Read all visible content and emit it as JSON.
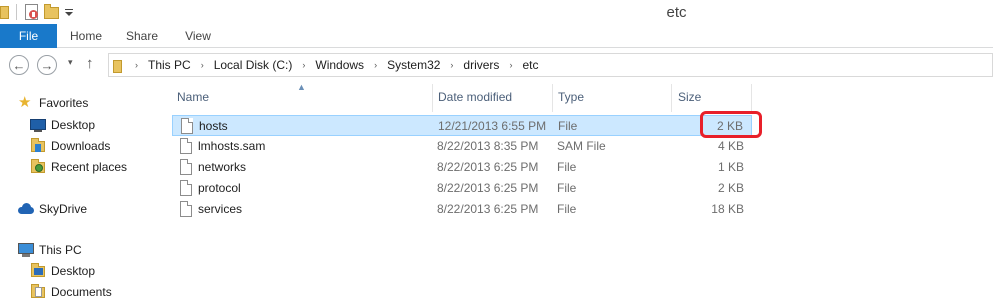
{
  "window": {
    "title": "etc"
  },
  "quick_access": {
    "icons": [
      "folder-icon",
      "properties-icon",
      "new-folder-icon",
      "customize-dropdown-icon"
    ]
  },
  "ribbon": {
    "tabs": [
      {
        "label": "File"
      },
      {
        "label": "Home"
      },
      {
        "label": "Share"
      },
      {
        "label": "View"
      }
    ]
  },
  "navigation": {
    "back": "←",
    "forward": "→",
    "recent": "▾",
    "up": "↑"
  },
  "address": {
    "crumbs": [
      "This PC",
      "Local Disk (C:)",
      "Windows",
      "System32",
      "drivers",
      "etc"
    ],
    "separator": "›"
  },
  "nav_pane": {
    "items": [
      {
        "label": "Favorites",
        "icon": "star-icon"
      },
      {
        "label": "Desktop",
        "icon": "desktop-icon"
      },
      {
        "label": "Downloads",
        "icon": "downloads-icon"
      },
      {
        "label": "Recent places",
        "icon": "recent-places-icon"
      },
      {
        "label": "SkyDrive",
        "icon": "skydrive-icon"
      },
      {
        "label": "This PC",
        "icon": "computer-icon"
      },
      {
        "label": "Desktop",
        "icon": "desktop-folder-icon"
      },
      {
        "label": "Documents",
        "icon": "documents-icon"
      }
    ]
  },
  "columns": {
    "name": "Name",
    "date": "Date modified",
    "type": "Type",
    "size": "Size"
  },
  "files": [
    {
      "name": "hosts",
      "date": "12/21/2013 6:55 PM",
      "type": "File",
      "size": "2 KB",
      "selected": true
    },
    {
      "name": "lmhosts.sam",
      "date": "8/22/2013 8:35 PM",
      "type": "SAM File",
      "size": "4 KB"
    },
    {
      "name": "networks",
      "date": "8/22/2013 6:25 PM",
      "type": "File",
      "size": "1 KB"
    },
    {
      "name": "protocol",
      "date": "8/22/2013 6:25 PM",
      "type": "File",
      "size": "2 KB"
    },
    {
      "name": "services",
      "date": "8/22/2013 6:25 PM",
      "type": "File",
      "size": "18 KB"
    }
  ],
  "colors": {
    "file_tab": "#1979ca",
    "selection": "#cce8ff",
    "annotation": "#e8202a"
  }
}
